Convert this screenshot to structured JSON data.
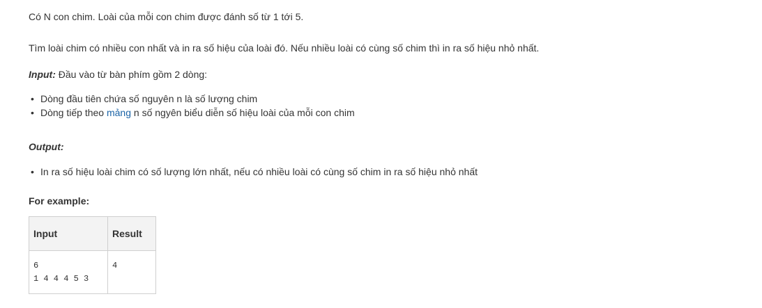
{
  "intro": "Có N con chim. Loài của mỗi con chim được đánh số từ 1 tới 5.",
  "task": "Tìm loài chim có nhiều con nhất và in ra số hiệu của loài đó. Nếu nhiều loài có cùng số chim thì in ra số hiệu nhỏ nhất.",
  "input_section": {
    "label": "Input:",
    "text": " Đầu vào từ bàn phím gồm 2 dòng:",
    "items": [
      {
        "text": "Dòng đầu tiên chứa số nguyên n là số lượng chim"
      },
      {
        "before": "Dòng tiếp theo ",
        "link": "mảng",
        "after": " n số ngyên biểu diễn số hiệu loài của mỗi con chim"
      }
    ]
  },
  "output_section": {
    "label": "Output:",
    "items": [
      "In ra số hiệu loài chim có số lượng lớn nhất, nếu có nhiều loài có cùng số chim in ra số hiệu nhỏ nhất"
    ]
  },
  "example": {
    "heading": "For example:",
    "headers": [
      "Input",
      "Result"
    ],
    "rows": [
      {
        "input": "6\n1 4 4 4 5 3",
        "result": "4"
      }
    ]
  },
  "bullet": "•"
}
